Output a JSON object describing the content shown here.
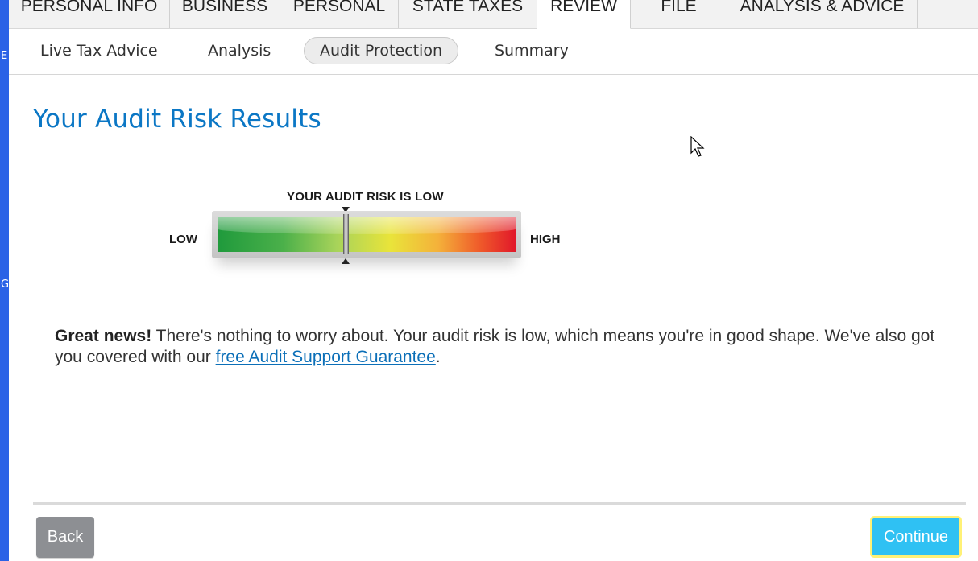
{
  "top_tabs": [
    {
      "label": "PERSONAL INFO",
      "active": false
    },
    {
      "label": "BUSINESS",
      "active": false
    },
    {
      "label": "PERSONAL",
      "active": false
    },
    {
      "label": "STATE TAXES",
      "active": false
    },
    {
      "label": "REVIEW",
      "active": true
    },
    {
      "label": "FILE",
      "active": false
    },
    {
      "label": "ANALYSIS & ADVICE",
      "active": false
    }
  ],
  "sub_nav": [
    {
      "label": "Live Tax Advice",
      "active": false
    },
    {
      "label": "Analysis",
      "active": false
    },
    {
      "label": "Audit Protection",
      "active": true
    },
    {
      "label": "Summary",
      "active": false
    }
  ],
  "page_title": "Your Audit Risk Results",
  "meter": {
    "caption": "YOUR AUDIT RISK IS LOW",
    "low_label": "LOW",
    "high_label": "HIGH",
    "level_fraction": 0.43
  },
  "message": {
    "lead": "Great news!",
    "body": " There's nothing to worry about. Your audit risk is low, which means you're in good shape. We've also got you covered with our ",
    "link": "free Audit Support Guarantee",
    "end": "."
  },
  "buttons": {
    "back": "Back",
    "continue": "Continue"
  },
  "colors": {
    "title": "#0b77c5",
    "continue_bg": "#2fc1f3",
    "back_bg": "#8d8f93",
    "link": "#0b6fb8"
  },
  "icons": {
    "pointer": "mouse-cursor-icon"
  }
}
